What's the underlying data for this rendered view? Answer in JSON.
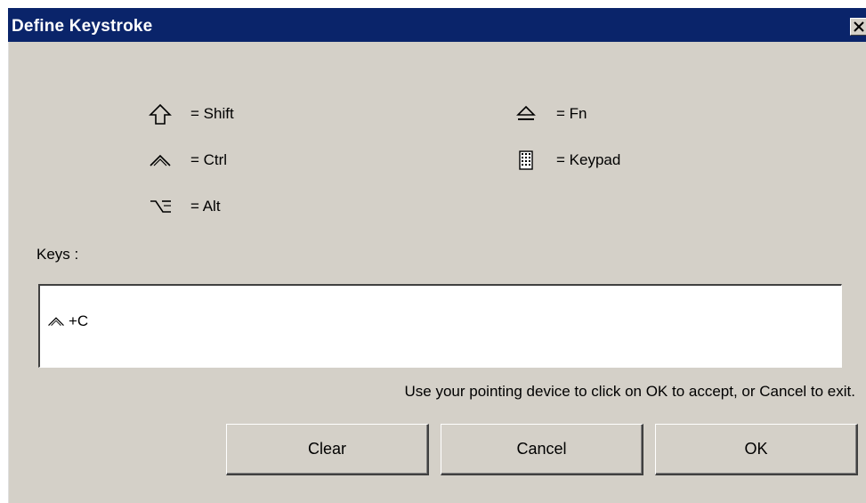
{
  "window": {
    "title": "Define Keystroke"
  },
  "legend": [
    {
      "icon": "shift-arrow-icon",
      "label": "= Shift"
    },
    {
      "icon": "ctrl-caret-icon",
      "label": "= Ctrl"
    },
    {
      "icon": "alt-key-icon",
      "label": "= Alt"
    },
    {
      "icon": "fn-eject-icon",
      "label": "= Fn"
    },
    {
      "icon": "keypad-icon",
      "label": "= Keypad"
    }
  ],
  "keys": {
    "label": "Keys :",
    "value": "+C",
    "value_icon": "ctrl-caret-icon"
  },
  "hint": "Use your pointing device to click on OK to accept, or Cancel to exit.",
  "buttons": {
    "clear": "Clear",
    "cancel": "Cancel",
    "ok": "OK"
  },
  "colors": {
    "titlebar": "#0a246a",
    "face": "#d4d0c8"
  }
}
